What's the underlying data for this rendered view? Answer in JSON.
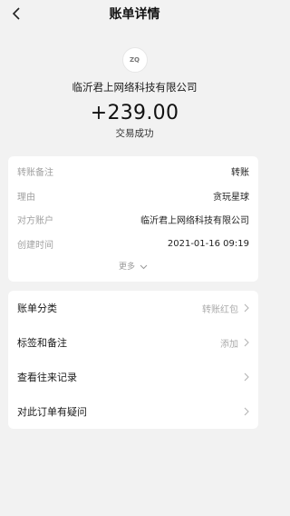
{
  "nav": {
    "title": "账单详情"
  },
  "header": {
    "logo_text": "ZQ",
    "merchant": "临沂君上网络科技有限公司",
    "amount": "+239.00",
    "status": "交易成功"
  },
  "details": [
    {
      "label": "转账备注",
      "value": "转账"
    },
    {
      "label": "理由",
      "value": "贪玩星球"
    },
    {
      "label": "对方账户",
      "value": "临沂君上网络科技有限公司"
    },
    {
      "label": "创建时间",
      "value": "2021-01-16 09:19"
    }
  ],
  "more_label": "更多",
  "menu": [
    {
      "label": "账单分类",
      "value": "转账红包"
    },
    {
      "label": "标签和备注",
      "value": "添加"
    },
    {
      "label": "查看往来记录",
      "value": ""
    },
    {
      "label": "对此订单有疑问",
      "value": ""
    }
  ]
}
